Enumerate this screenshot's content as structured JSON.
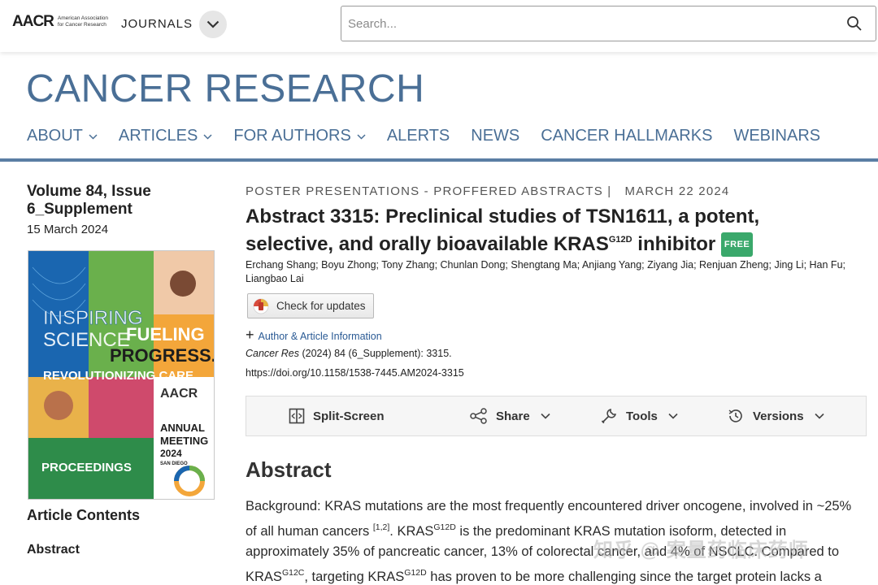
{
  "header": {
    "logo_text": "AACR",
    "logo_subtext": "American Association for Cancer Research",
    "journals_label": "JOURNALS",
    "search_placeholder": "Search..."
  },
  "journal": {
    "title": "CANCER RESEARCH",
    "nav": [
      {
        "label": "ABOUT",
        "dropdown": true
      },
      {
        "label": "ARTICLES",
        "dropdown": true
      },
      {
        "label": "FOR AUTHORS",
        "dropdown": true
      },
      {
        "label": "ALERTS",
        "dropdown": false
      },
      {
        "label": "NEWS",
        "dropdown": false
      },
      {
        "label": "CANCER HALLMARKS",
        "dropdown": false
      },
      {
        "label": "WEBINARS",
        "dropdown": false
      }
    ]
  },
  "sidebar": {
    "volume": "Volume 84, Issue 6_Supplement",
    "date": "15 March 2024",
    "cover": {
      "line1": "INSPIRING",
      "line2": "SCIENCE",
      "line3": "FUELING",
      "line4": "PROGRESS.",
      "line5": "REVOLUTIONIZING CARE.",
      "proceedings": "PROCEEDINGS",
      "aacr": "AACR",
      "annual": "ANNUAL",
      "meeting": "MEETING",
      "year": "2024",
      "city": "SAN DIEGO"
    },
    "contents_heading": "Article Contents",
    "toc_items": [
      "Abstract"
    ]
  },
  "article": {
    "category": "POSTER PRESENTATIONS - PROFFERED ABSTRACTS |",
    "date": "MARCH 22 2024",
    "title_part1": "Abstract 3315: Preclinical studies of TSN1611, a potent, selective, and orally bioavailable KRAS",
    "title_sup": "G12D",
    "title_part2": " inhibitor ",
    "free_badge": "FREE",
    "authors": "Erchang Shang; Boyu Zhong; Tony Zhang; Chunlan Dong; Shengtang Ma; Anjiang Yang; Ziyang Jia; Renjuan Zheng; Jing Li; Han Fu; Liangbao Lai",
    "check_updates": "Check for updates",
    "author_info": "Author & Article Information",
    "citation_journal": "Cancer Res",
    "citation_rest": " (2024) 84 (6_Supplement): 3315.",
    "doi": "https://doi.org/10.1158/1538-7445.AM2024-3315",
    "toolbar": {
      "split_screen": "Split-Screen",
      "share": "Share",
      "tools": "Tools",
      "versions": "Versions"
    },
    "abstract_heading": "Abstract",
    "abstract_seg1": "Background: KRAS mutations are the most frequently encountered driver oncogene, involved in ~25% of all human cancers ",
    "abstract_ref1": "[1,2]",
    "abstract_seg2": ". KRAS",
    "abstract_sup1": "G12D",
    "abstract_seg3": " is the predominant KRAS mutation isoform, detected in approximately 35% of pancreatic cancer, 13% of colorectal cancer, and 4% of NSCLC. Compared to KRAS",
    "abstract_sup2": "G12C",
    "abstract_seg4": ", targeting KRAS",
    "abstract_sup3": "G12D",
    "abstract_seg5": " has proven to be more challenging since the target protein lacks a"
  },
  "watermark": "知乎 @ 案量药临床药师",
  "colors": {
    "brand_blue": "#4a6f96",
    "link_blue": "#2a5a94",
    "free_green": "#3aa86b"
  }
}
